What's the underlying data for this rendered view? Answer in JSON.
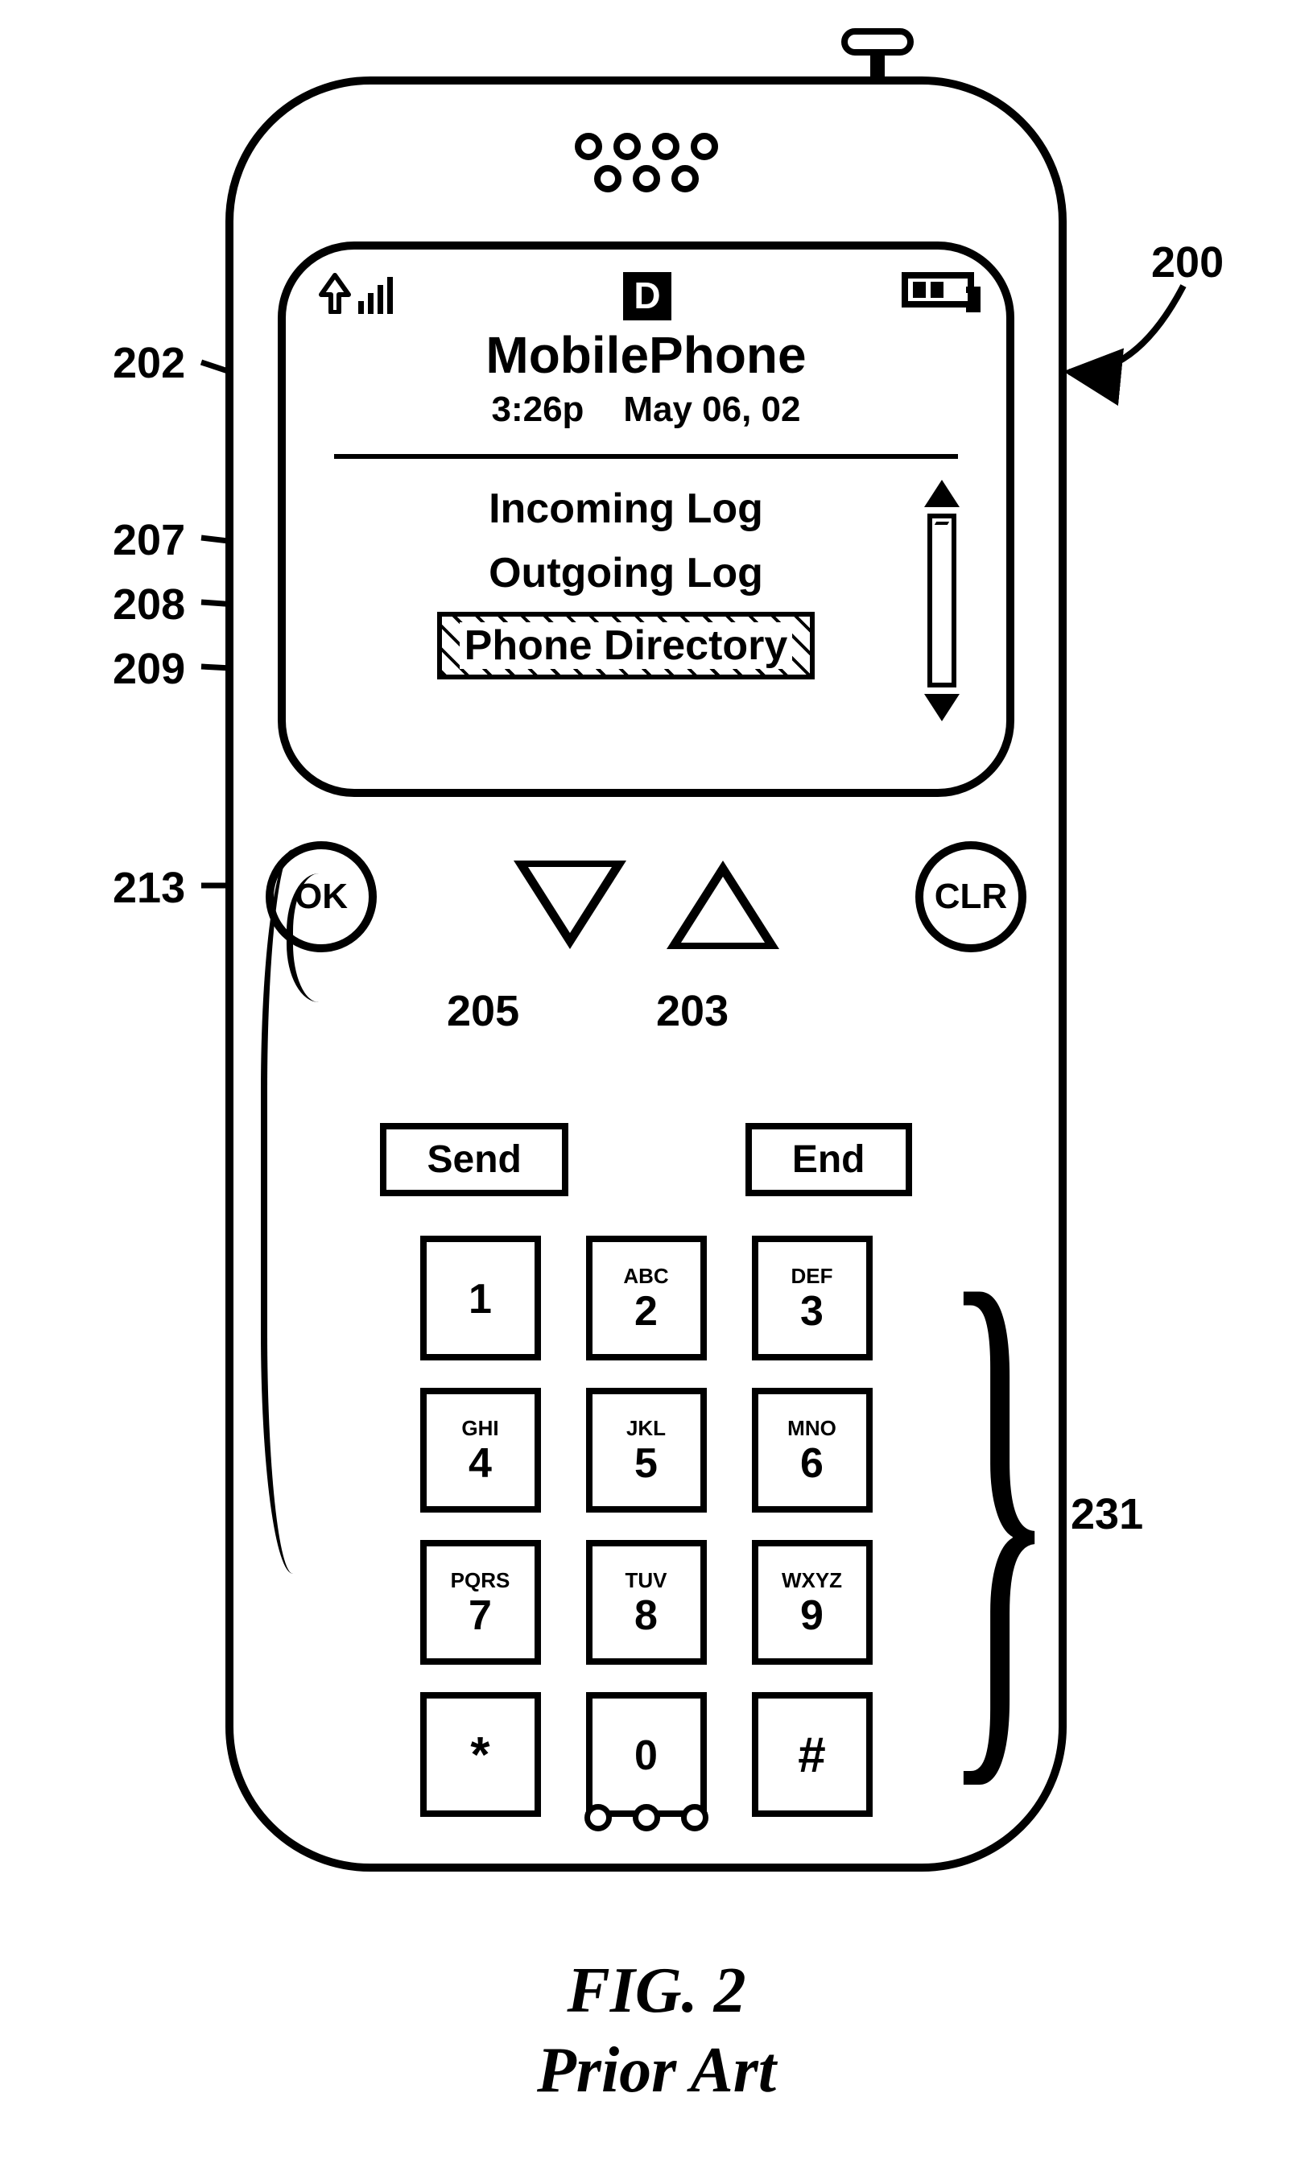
{
  "figure": {
    "label": "FIG. 2",
    "subtitle": "Prior Art"
  },
  "refs": {
    "r200": "200",
    "r202": "202",
    "r203": "203",
    "r205": "205",
    "r207": "207",
    "r208": "208",
    "r209": "209",
    "r213": "213",
    "r231": "231"
  },
  "status": {
    "mode_letter": "D",
    "signal_bars": 4,
    "battery_cells": 2
  },
  "header": {
    "title": "MobilePhone",
    "time": "3:26p",
    "date": "May 06, 02"
  },
  "menu": {
    "items": [
      {
        "label": "Incoming Log",
        "selected": false
      },
      {
        "label": "Outgoing Log",
        "selected": false
      },
      {
        "label": "Phone Directory",
        "selected": true
      }
    ]
  },
  "buttons": {
    "ok": "OK",
    "clr": "CLR",
    "send": "Send",
    "end": "End"
  },
  "keypad": [
    {
      "letters": "",
      "digit": "1"
    },
    {
      "letters": "ABC",
      "digit": "2"
    },
    {
      "letters": "DEF",
      "digit": "3"
    },
    {
      "letters": "GHI",
      "digit": "4"
    },
    {
      "letters": "JKL",
      "digit": "5"
    },
    {
      "letters": "MNO",
      "digit": "6"
    },
    {
      "letters": "PQRS",
      "digit": "7"
    },
    {
      "letters": "TUV",
      "digit": "8"
    },
    {
      "letters": "WXYZ",
      "digit": "9"
    },
    {
      "letters": "",
      "digit": "*"
    },
    {
      "letters": "",
      "digit": "0"
    },
    {
      "letters": "",
      "digit": "#"
    }
  ]
}
